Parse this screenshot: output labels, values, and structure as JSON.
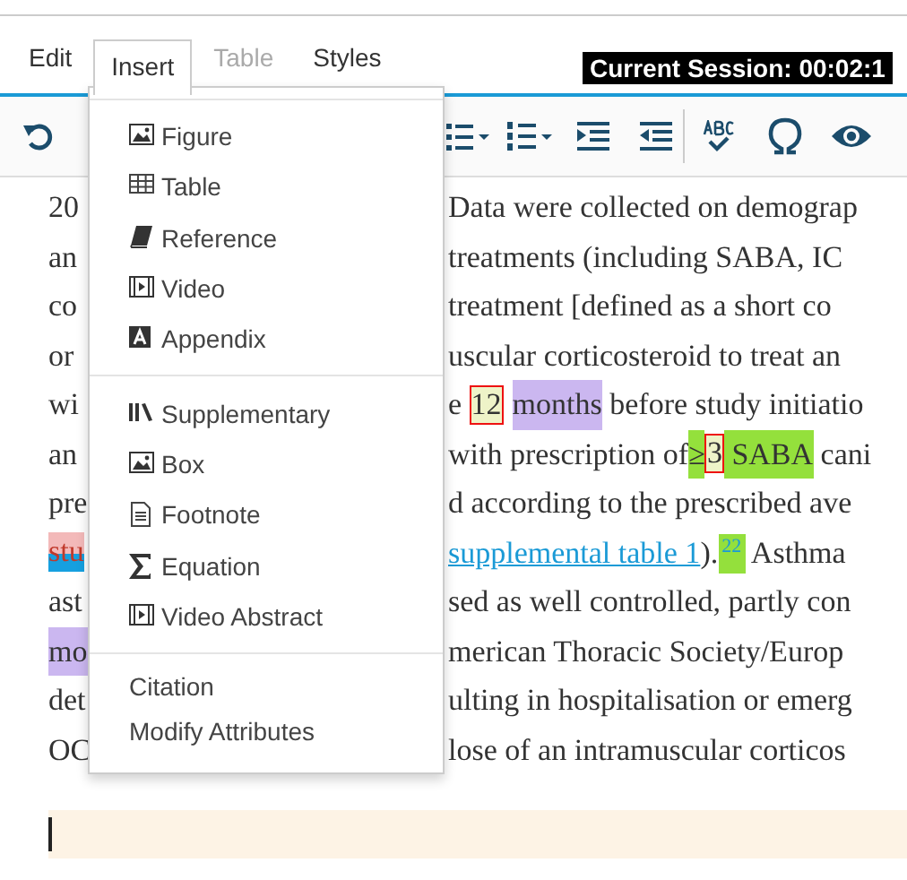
{
  "menubar": {
    "items": [
      {
        "label": "Edit",
        "selected": false,
        "disabled": false
      },
      {
        "label": "Insert",
        "selected": true,
        "disabled": false
      },
      {
        "label": "Table",
        "selected": false,
        "disabled": true
      },
      {
        "label": "Styles",
        "selected": false,
        "disabled": false
      }
    ],
    "session": "Current Session: 00:02:1"
  },
  "document": {
    "lines": [
      {
        "left": [
          {
            "kind": "plain",
            "text": "20"
          }
        ],
        "right": [
          {
            "kind": "plain",
            "text": "Data were collected on demograp"
          }
        ]
      },
      {
        "left": [
          {
            "kind": "plain",
            "text": "an"
          }
        ],
        "right": [
          {
            "kind": "plain",
            "text": "treatments (including SABA, IC"
          }
        ]
      },
      {
        "left": [
          {
            "kind": "plain",
            "text": "co"
          }
        ],
        "right": [
          {
            "kind": "plain",
            "text": "treatment [defined as a short co"
          }
        ]
      },
      {
        "left": [
          {
            "kind": "plain",
            "text": "or"
          }
        ],
        "right": [
          {
            "kind": "plain",
            "text": "uscular corticosteroid to treat an"
          }
        ]
      },
      {
        "left": [
          {
            "kind": "plain",
            "text": "wi"
          }
        ],
        "right": [
          {
            "kind": "plain",
            "text": "e "
          },
          {
            "kind": "boxed",
            "text": "12"
          },
          {
            "kind": "purple",
            "text": "months"
          },
          {
            "kind": "plain",
            "text": " before study initiatio"
          }
        ]
      },
      {
        "left": [
          {
            "kind": "plain",
            "text": "an"
          }
        ],
        "right": [
          {
            "kind": "plain",
            "text": "with prescription of"
          },
          {
            "kind": "green",
            "text": "≥"
          },
          {
            "kind": "boxed",
            "text": "3"
          },
          {
            "kind": "green",
            "text": " SABA"
          },
          {
            "kind": "plain",
            "text": " cani"
          }
        ]
      },
      {
        "left": [
          {
            "kind": "plain",
            "text": "pre"
          }
        ],
        "right": [
          {
            "kind": "plain",
            "text": "d according to the prescribed ave"
          }
        ]
      },
      {
        "left": [
          {
            "kind": "tracked",
            "text": "stu"
          }
        ],
        "right": [
          {
            "kind": "link",
            "text": "supplemental table 1"
          },
          {
            "kind": "plain",
            "text": ")."
          },
          {
            "kind": "sup",
            "text": "22"
          },
          {
            "kind": "plain",
            "text": " Asthma"
          }
        ]
      },
      {
        "left": [
          {
            "kind": "plain",
            "text": "ast"
          }
        ],
        "right": [
          {
            "kind": "plain",
            "text": "sed as well controlled, partly con"
          }
        ]
      },
      {
        "left": [
          {
            "kind": "purple",
            "text": "mo"
          }
        ],
        "right": [
          {
            "kind": "plain",
            "text": "merican Thoracic Society/Europ"
          }
        ]
      },
      {
        "left": [
          {
            "kind": "plain",
            "text": "det"
          }
        ],
        "right": [
          {
            "kind": "plain",
            "text": "ulting in hospitalisation or emerg"
          }
        ]
      },
      {
        "left": [
          {
            "kind": "plain",
            "text": "OC"
          }
        ],
        "right": [
          {
            "kind": "plain",
            "text": "lose of an intramuscular corticos"
          }
        ]
      }
    ]
  },
  "insert_menu": {
    "sections": [
      {
        "items": [
          {
            "kind": "figure",
            "label": "Figure"
          },
          {
            "kind": "table",
            "label": "Table"
          },
          {
            "kind": "reference",
            "label": "Reference"
          },
          {
            "kind": "video",
            "label": "Video"
          },
          {
            "kind": "appendix",
            "label": "Appendix"
          }
        ]
      },
      {
        "items": [
          {
            "kind": "supplementary",
            "label": "Supplementary"
          },
          {
            "kind": "figure",
            "label": "Box"
          },
          {
            "kind": "footnote",
            "label": "Footnote"
          },
          {
            "kind": "equation",
            "label": "Equation"
          },
          {
            "kind": "video",
            "label": "Video Abstract"
          }
        ]
      },
      {
        "items": [
          {
            "kind": "text",
            "label": "Citation"
          },
          {
            "kind": "text",
            "label": "Modify Attributes"
          }
        ]
      }
    ]
  }
}
